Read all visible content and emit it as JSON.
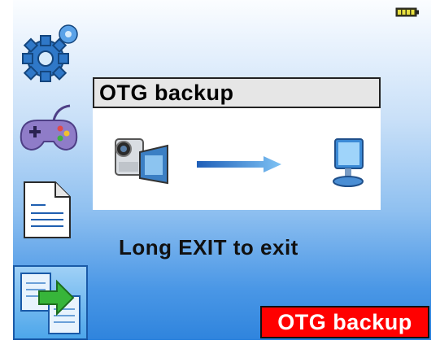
{
  "dialog": {
    "title": "OTG backup",
    "source_icon": "camcorder-icon",
    "direction_icon": "arrow-right-icon",
    "target_icon": "computer-icon"
  },
  "hint": "Long EXIT to exit",
  "status_badge": "OTG backup",
  "sidebar": {
    "items": [
      {
        "name": "settings",
        "icon": "gears-icon"
      },
      {
        "name": "games",
        "icon": "gamepad-icon"
      },
      {
        "name": "documents",
        "icon": "document-icon"
      },
      {
        "name": "otg-backup",
        "icon": "backup-transfer-icon",
        "selected": true
      }
    ]
  },
  "colors": {
    "badge_background": "#ff0000",
    "badge_text": "#ffffff",
    "panel_gradient_top": "#fbfdff",
    "panel_gradient_bottom": "#2f84dd"
  },
  "battery_icon": "battery-full-icon"
}
